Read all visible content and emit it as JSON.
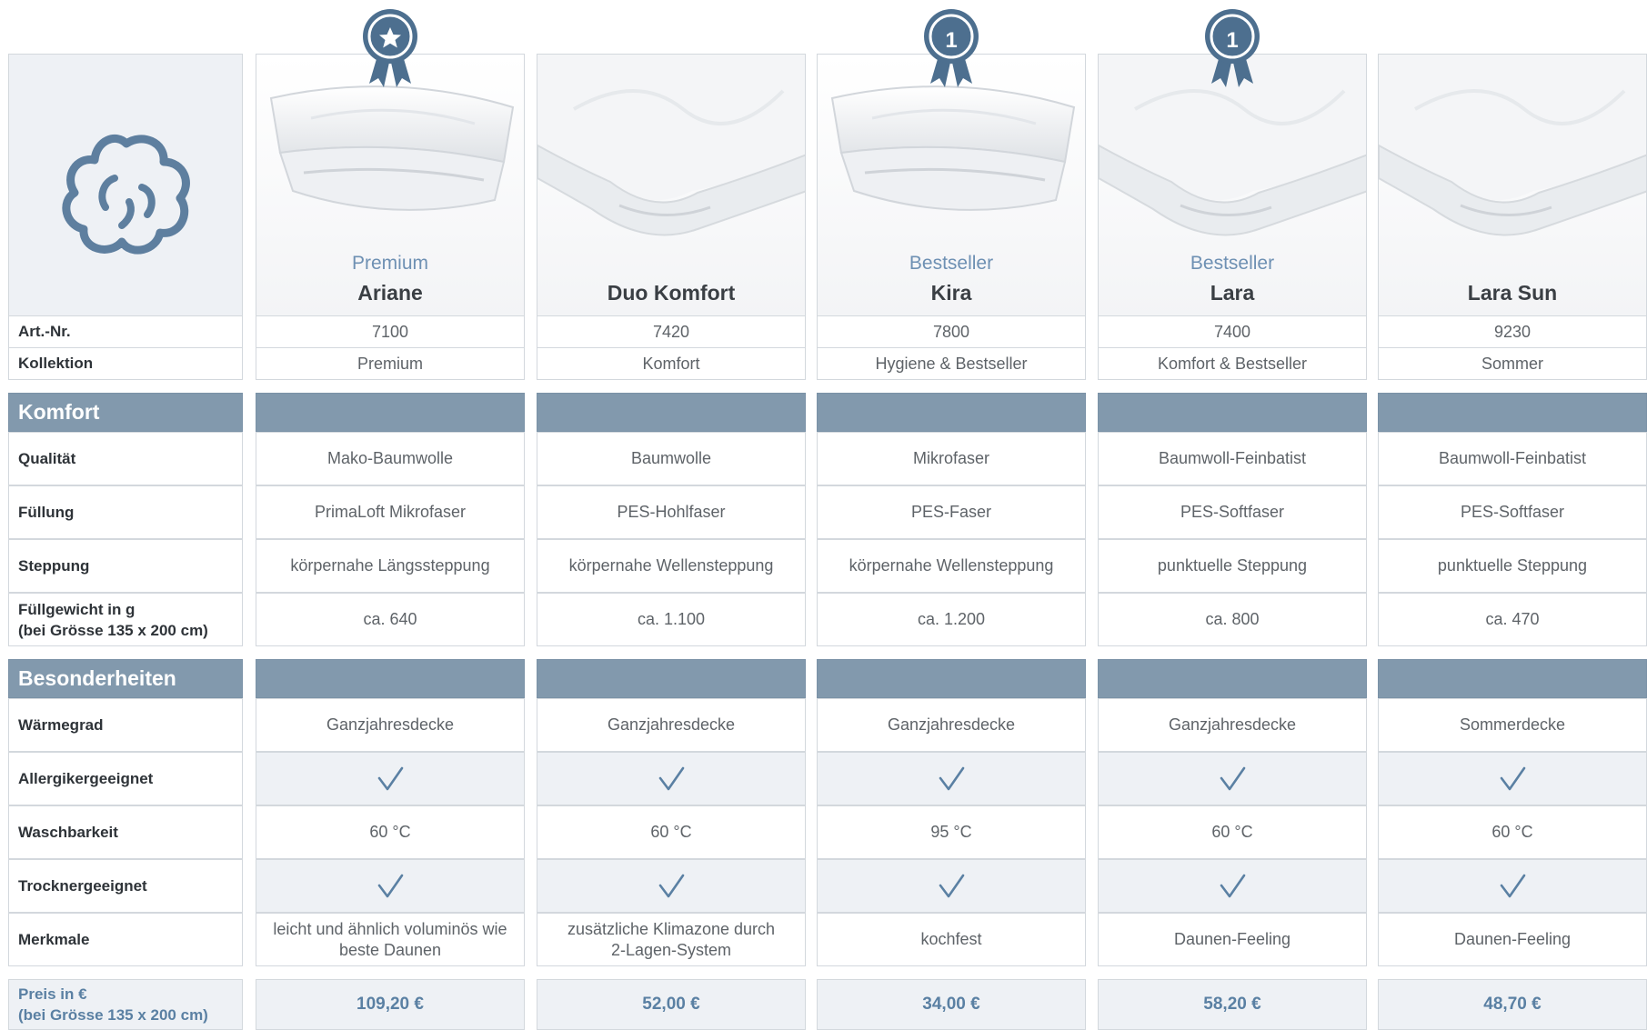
{
  "logo_icon": "cotton-flower-icon",
  "colors": {
    "accent": "#5a80a3",
    "section_header": "#8299ad",
    "badge": "#4d6f8f",
    "alt_row": "#eef1f5",
    "border": "#d3d8dd"
  },
  "products": [
    {
      "subtitle": "Premium",
      "name": "Ariane",
      "badge": "star-ribbon-icon",
      "badge_text": ""
    },
    {
      "subtitle": "",
      "name": "Duo Komfort",
      "badge": "",
      "badge_text": ""
    },
    {
      "subtitle": "Bestseller",
      "name": "Kira",
      "badge": "number-one-ribbon-icon",
      "badge_text": "1"
    },
    {
      "subtitle": "Bestseller",
      "name": "Lara",
      "badge": "number-one-ribbon-icon",
      "badge_text": "1"
    },
    {
      "subtitle": "",
      "name": "Lara Sun",
      "badge": "",
      "badge_text": ""
    }
  ],
  "info_rows": [
    {
      "label": "Art.-Nr.",
      "values": [
        "7100",
        "7420",
        "7800",
        "7400",
        "9230"
      ]
    },
    {
      "label": "Kollektion",
      "values": [
        "Premium",
        "Komfort",
        "Hygiene & Bestseller",
        "Komfort & Bestseller",
        "Sommer"
      ]
    }
  ],
  "sections": [
    {
      "title": "Komfort",
      "rows": [
        {
          "label": "Qualität",
          "values": [
            "Mako-Baumwolle",
            "Baumwolle",
            "Mikrofaser",
            "Baumwoll-Feinbatist",
            "Baumwoll-Feinbatist"
          ]
        },
        {
          "label": "Füllung",
          "values": [
            "PrimaLoft Mikrofaser",
            "PES-Hohlfaser",
            "PES-Faser",
            "PES-Softfaser",
            "PES-Softfaser"
          ]
        },
        {
          "label": "Steppung",
          "values": [
            "körpernahe Längssteppung",
            "körpernahe Wellensteppung",
            "körpernahe Wellensteppung",
            "punktuelle Steppung",
            "punktuelle Steppung"
          ]
        },
        {
          "label_line1": "Füllgewicht in g",
          "label_line2": "(bei Grösse 135 x 200 cm)",
          "values": [
            "ca. 640",
            "ca. 1.100",
            "ca. 1.200",
            "ca. 800",
            "ca. 470"
          ]
        }
      ]
    },
    {
      "title": "Besonderheiten",
      "rows": [
        {
          "label": "Wärmegrad",
          "values": [
            "Ganzjahresdecke",
            "Ganzjahresdecke",
            "Ganzjahresdecke",
            "Ganzjahresdecke",
            "Sommerdecke"
          ]
        },
        {
          "label": "Allergikergeeignet",
          "check": true,
          "icon": "checkmark-icon"
        },
        {
          "label": "Waschbarkeit",
          "values": [
            "60 °C",
            "60 °C",
            "95 °C",
            "60 °C",
            "60 °C"
          ]
        },
        {
          "label": "Trocknergeeignet",
          "check": true,
          "icon": "checkmark-icon"
        },
        {
          "label": "Merkmale",
          "values_line1": [
            "leicht und ähnlich voluminös wie",
            "zusätzliche Klimazone durch",
            "kochfest",
            "Daunen-Feeling",
            "Daunen-Feeling"
          ],
          "values_line2": [
            "beste Daunen",
            "2-Lagen-System",
            "",
            "",
            ""
          ]
        }
      ]
    }
  ],
  "price": {
    "label_line1": "Preis in €",
    "label_line2": "(bei Grösse 135 x 200 cm)",
    "values": [
      "109,20 €",
      "52,00 €",
      "34,00 €",
      "58,20 €",
      "48,70 €"
    ]
  }
}
